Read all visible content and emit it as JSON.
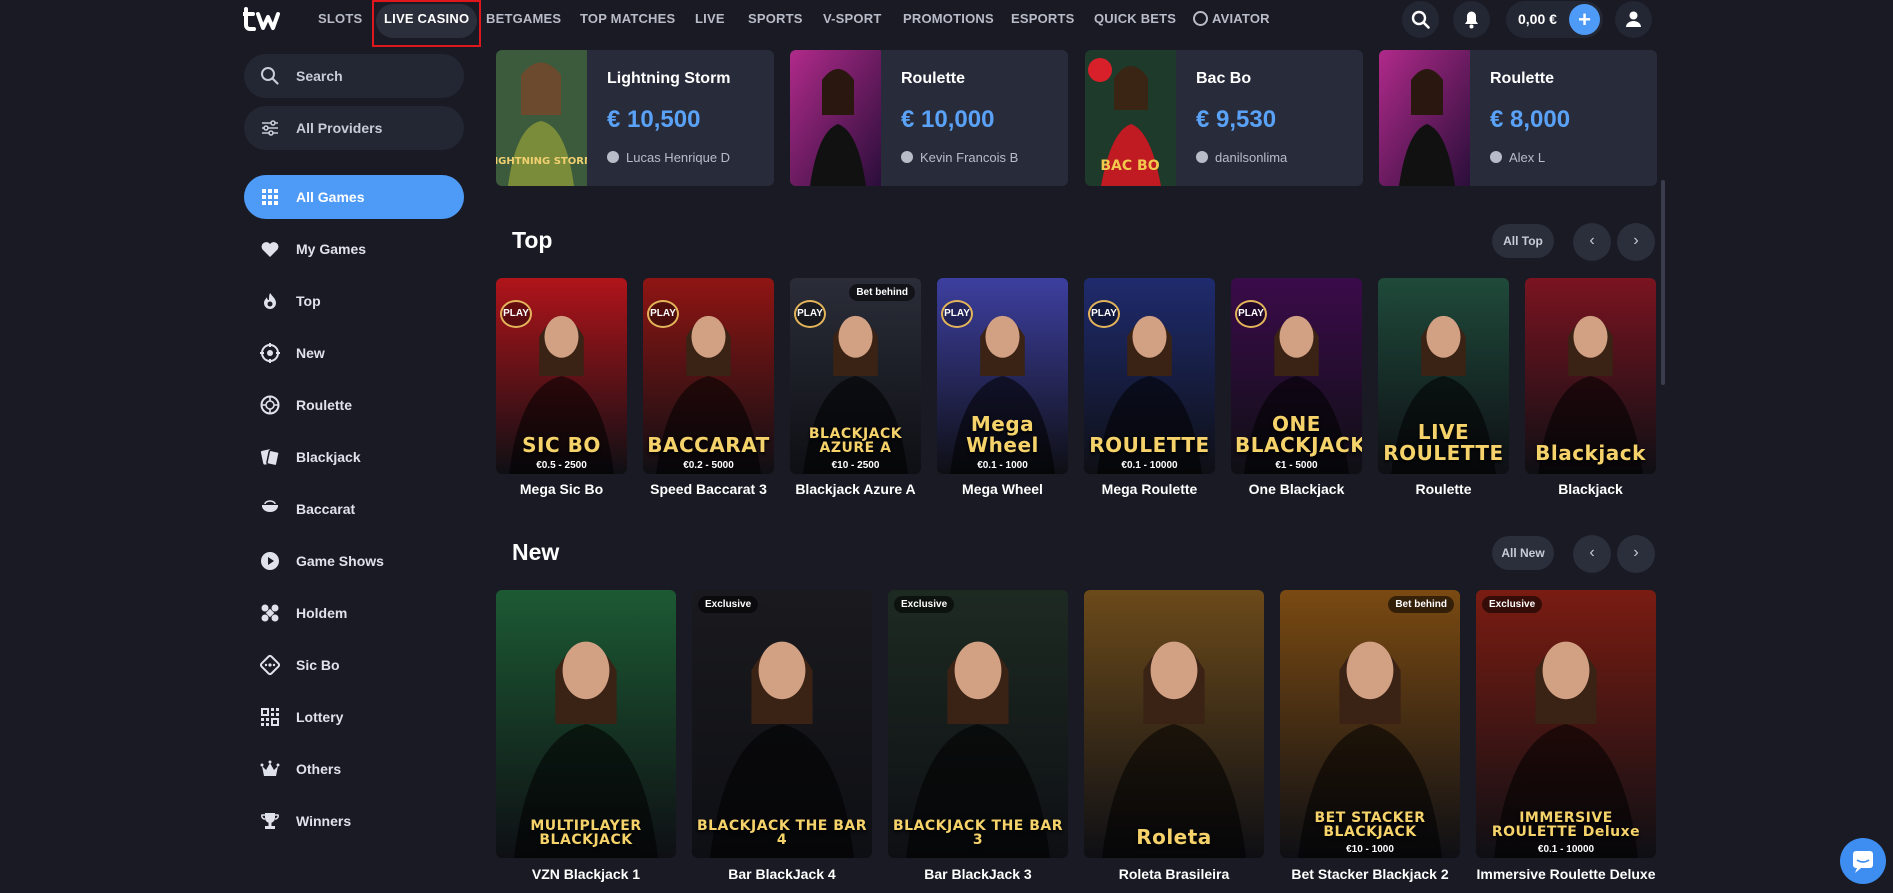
{
  "nav": {
    "items": [
      "SLOTS",
      "LIVE CASINO",
      "BETGAMES",
      "TOP MATCHES",
      "LIVE",
      "SPORTS",
      "V-SPORT",
      "PROMOTIONS",
      "ESPORTS",
      "QUICK BETS",
      "AVIATOR"
    ],
    "active": "LIVE CASINO",
    "balance": "0,00 €",
    "plus": "+"
  },
  "sidebar": {
    "search": "Search",
    "providers": "All Providers",
    "items": [
      {
        "label": "All Games",
        "icon": "grid-icon",
        "active": true
      },
      {
        "label": "My Games",
        "icon": "heart-icon"
      },
      {
        "label": "Top",
        "icon": "flame-icon"
      },
      {
        "label": "New",
        "icon": "new-badge-icon"
      },
      {
        "label": "Roulette",
        "icon": "roulette-icon"
      },
      {
        "label": "Blackjack",
        "icon": "cards-icon"
      },
      {
        "label": "Baccarat",
        "icon": "baccarat-icon"
      },
      {
        "label": "Game Shows",
        "icon": "play-circle-icon"
      },
      {
        "label": "Holdem",
        "icon": "chips-icon"
      },
      {
        "label": "Sic Bo",
        "icon": "dice-icon"
      },
      {
        "label": "Lottery",
        "icon": "lottery-icon"
      },
      {
        "label": "Others",
        "icon": "crown-icon"
      },
      {
        "label": "Winners",
        "icon": "trophy-icon"
      }
    ]
  },
  "winners": [
    {
      "game": "Lightning Storm",
      "amount": "€ 10,500",
      "user": "Lucas Henrique D",
      "thumb_title": "LIGHTNING STORM"
    },
    {
      "game": "Roulette",
      "amount": "€ 10,000",
      "user": "Kevin Francois B",
      "thumb_title": ""
    },
    {
      "game": "Bac Bo",
      "amount": "€ 9,530",
      "user": "danilsonlima",
      "thumb_title": "BAC BO"
    },
    {
      "game": "Roulette",
      "amount": "€ 8,000",
      "user": "Alex L",
      "thumb_title": ""
    }
  ],
  "top": {
    "title": "Top",
    "all_label": "All Top",
    "prev": "‹",
    "next": "›",
    "games": [
      {
        "name": "Mega Sic Bo",
        "art": "SIC BO",
        "limit": "€0.5 - 2500",
        "play": true,
        "tag": "",
        "bg": "#b0141a"
      },
      {
        "name": "Speed Baccarat 3",
        "art": "BACCARAT",
        "limit": "€0.2 - 5000",
        "play": true,
        "tag": "",
        "bg": "#8f1513"
      },
      {
        "name": "Blackjack Azure A",
        "art": "BLACKJACK AZURE A",
        "limit": "€10 - 2500",
        "play": true,
        "tag": "Bet behind",
        "bg": "#2a2d38"
      },
      {
        "name": "Mega Wheel",
        "art": "Mega Wheel",
        "limit": "€0.1 - 1000",
        "play": true,
        "tag": "",
        "bg": "#3d3fa0"
      },
      {
        "name": "Mega Roulette",
        "art": "ROULETTE",
        "limit": "€0.1 - 10000",
        "play": true,
        "tag": "",
        "bg": "#1f2b6e"
      },
      {
        "name": "One Blackjack",
        "art": "ONE BLACKJACK",
        "limit": "€1 - 5000",
        "play": true,
        "tag": "",
        "bg": "#3b0b4a"
      },
      {
        "name": "Roulette",
        "art": "LIVE ROULETTE",
        "limit": "",
        "play": false,
        "tag": "",
        "bg": "#1f4a3a"
      },
      {
        "name": "Blackjack",
        "art": "Blackjack",
        "limit": "",
        "play": false,
        "tag": "",
        "bg": "#7a1420"
      }
    ]
  },
  "new": {
    "title": "New",
    "all_label": "All New",
    "prev": "‹",
    "next": "›",
    "games": [
      {
        "name": "VZN Blackjack 1",
        "art": "MULTIPLAYER BLACKJACK",
        "limit": "",
        "tag": "",
        "bg": "#1c5a33"
      },
      {
        "name": "Bar BlackJack 4",
        "art": "BLACKJACK THE BAR 4",
        "limit": "",
        "tag": "Exclusive",
        "bg": "#1a1a1e"
      },
      {
        "name": "Bar BlackJack 3",
        "art": "BLACKJACK THE BAR 3",
        "limit": "",
        "tag": "Exclusive",
        "bg": "#1d2a22"
      },
      {
        "name": "Roleta Brasileira",
        "art": "Roleta",
        "limit": "",
        "tag": "",
        "bg": "#6b4a1a"
      },
      {
        "name": "Bet Stacker Blackjack 2",
        "art": "BET STACKER BLACKJACK",
        "limit": "€10 - 1000",
        "tag": "Bet behind",
        "bg": "#7a4a12"
      },
      {
        "name": "Immersive Roulette Deluxe",
        "art": "IMMERSIVE ROULETTE Deluxe",
        "limit": "€0.1 - 10000",
        "tag": "Exclusive",
        "bg": "#7a1c12"
      }
    ]
  },
  "colors": {
    "accent": "#4e9bf7",
    "background": "#191a23",
    "panel": "#232633",
    "highlight_border": "#e0161d"
  }
}
